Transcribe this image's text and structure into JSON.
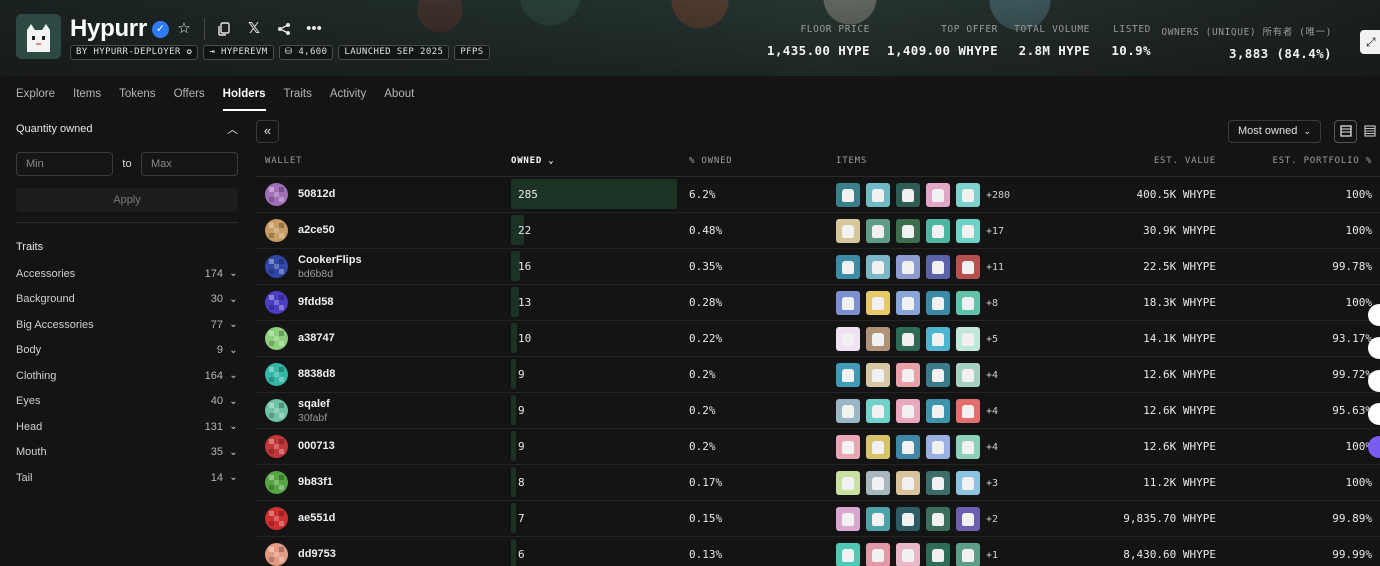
{
  "collection": {
    "name": "Hypurr",
    "tags": [
      "BY HYPURR-DEPLOYER ✪",
      "⇥ HYPEREVM",
      "⛁ 4,600",
      "LAUNCHED SEP 2025",
      "PFPS"
    ]
  },
  "stats": [
    {
      "label": "FLOOR PRICE",
      "value": "1,435.00 HYPE"
    },
    {
      "label": "TOP OFFER",
      "value": "1,409.00 WHYPE"
    },
    {
      "label": "TOTAL VOLUME",
      "value": "2.8M HYPE"
    },
    {
      "label": "LISTED",
      "value": "10.9%"
    },
    {
      "label": "OWNERS (UNIQUE)  所有者 (唯一)",
      "value": "3,883 (84.4%)"
    }
  ],
  "tabs": [
    "Explore",
    "Items",
    "Tokens",
    "Offers",
    "Holders",
    "Traits",
    "Activity",
    "About"
  ],
  "active_tab": "Holders",
  "sidebar": {
    "quantity_title": "Quantity owned",
    "min_placeholder": "Min",
    "to_label": "to",
    "max_placeholder": "Max",
    "apply_label": "Apply",
    "traits_title": "Traits",
    "traits": [
      {
        "name": "Accessories",
        "count": "174"
      },
      {
        "name": "Background",
        "count": "30"
      },
      {
        "name": "Big Accessories",
        "count": "77"
      },
      {
        "name": "Body",
        "count": "9"
      },
      {
        "name": "Clothing",
        "count": "164"
      },
      {
        "name": "Eyes",
        "count": "40"
      },
      {
        "name": "Head",
        "count": "131"
      },
      {
        "name": "Mouth",
        "count": "35"
      },
      {
        "name": "Tail",
        "count": "14"
      }
    ]
  },
  "toolbar": {
    "sort_label": "Most owned"
  },
  "table": {
    "headers": {
      "wallet": "WALLET",
      "owned": "OWNED ⌄",
      "pct": "% OWNED",
      "items": "ITEMS",
      "est": "EST. VALUE",
      "port": "EST. PORTFOLIO %"
    },
    "rows": [
      {
        "wallet": "50812d",
        "sub": "",
        "owned": "285",
        "owned_fraction": 1.0,
        "pct": "6.2%",
        "more": "+280",
        "est": "400.5K WHYPE",
        "port": "100%",
        "avatar": "#a06fb7"
      },
      {
        "wallet": "a2ce50",
        "sub": "",
        "owned": "22",
        "owned_fraction": 0.077,
        "pct": "0.48%",
        "more": "+17",
        "est": "30.9K WHYPE",
        "port": "100%",
        "avatar": "#c89c62"
      },
      {
        "wallet": "CookerFlips",
        "sub": "bd6b8d",
        "owned": "16",
        "owned_fraction": 0.056,
        "pct": "0.35%",
        "more": "+11",
        "est": "22.5K WHYPE",
        "port": "99.78%",
        "avatar": "#3047a8"
      },
      {
        "wallet": "9fdd58",
        "sub": "",
        "owned": "13",
        "owned_fraction": 0.046,
        "pct": "0.28%",
        "more": "+8",
        "est": "18.3K WHYPE",
        "port": "100%",
        "avatar": "#4c3ec4"
      },
      {
        "wallet": "a38747",
        "sub": "",
        "owned": "10",
        "owned_fraction": 0.035,
        "pct": "0.22%",
        "more": "+5",
        "est": "14.1K WHYPE",
        "port": "93.17%",
        "avatar": "#8ed07c"
      },
      {
        "wallet": "8838d8",
        "sub": "",
        "owned": "9",
        "owned_fraction": 0.032,
        "pct": "0.2%",
        "more": "+4",
        "est": "12.6K WHYPE",
        "port": "99.72%",
        "avatar": "#35b7a8"
      },
      {
        "wallet": "sqalef",
        "sub": "30fabf",
        "owned": "9",
        "owned_fraction": 0.032,
        "pct": "0.2%",
        "more": "+4",
        "est": "12.6K WHYPE",
        "port": "95.63%",
        "avatar": "#6fc3a6"
      },
      {
        "wallet": "000713",
        "sub": "",
        "owned": "9",
        "owned_fraction": 0.032,
        "pct": "0.2%",
        "more": "+4",
        "est": "12.6K WHYPE",
        "port": "100%",
        "avatar": "#c2373a"
      },
      {
        "wallet": "9b83f1",
        "sub": "",
        "owned": "8",
        "owned_fraction": 0.028,
        "pct": "0.17%",
        "more": "+3",
        "est": "11.2K WHYPE",
        "port": "100%",
        "avatar": "#56a543"
      },
      {
        "wallet": "ae551d",
        "sub": "",
        "owned": "7",
        "owned_fraction": 0.025,
        "pct": "0.15%",
        "more": "+2",
        "est": "9,835.70 WHYPE",
        "port": "99.89%",
        "avatar": "#cf2f2f"
      },
      {
        "wallet": "dd9753",
        "sub": "",
        "owned": "6",
        "owned_fraction": 0.021,
        "pct": "0.13%",
        "more": "+1",
        "est": "8,430.60 WHYPE",
        "port": "99.99%",
        "avatar": "#e39a82"
      }
    ]
  },
  "colors": {
    "accent_bar": "#1b3325",
    "verified": "#2f7bf5",
    "background": "#141414"
  },
  "icons": [
    "verified-icon",
    "star-icon",
    "copy-icon",
    "x-icon",
    "share-icon",
    "more-icon",
    "chevron-up-icon",
    "chevron-down-icon",
    "collapse-icon",
    "grid-view-icon",
    "list-view-icon"
  ]
}
